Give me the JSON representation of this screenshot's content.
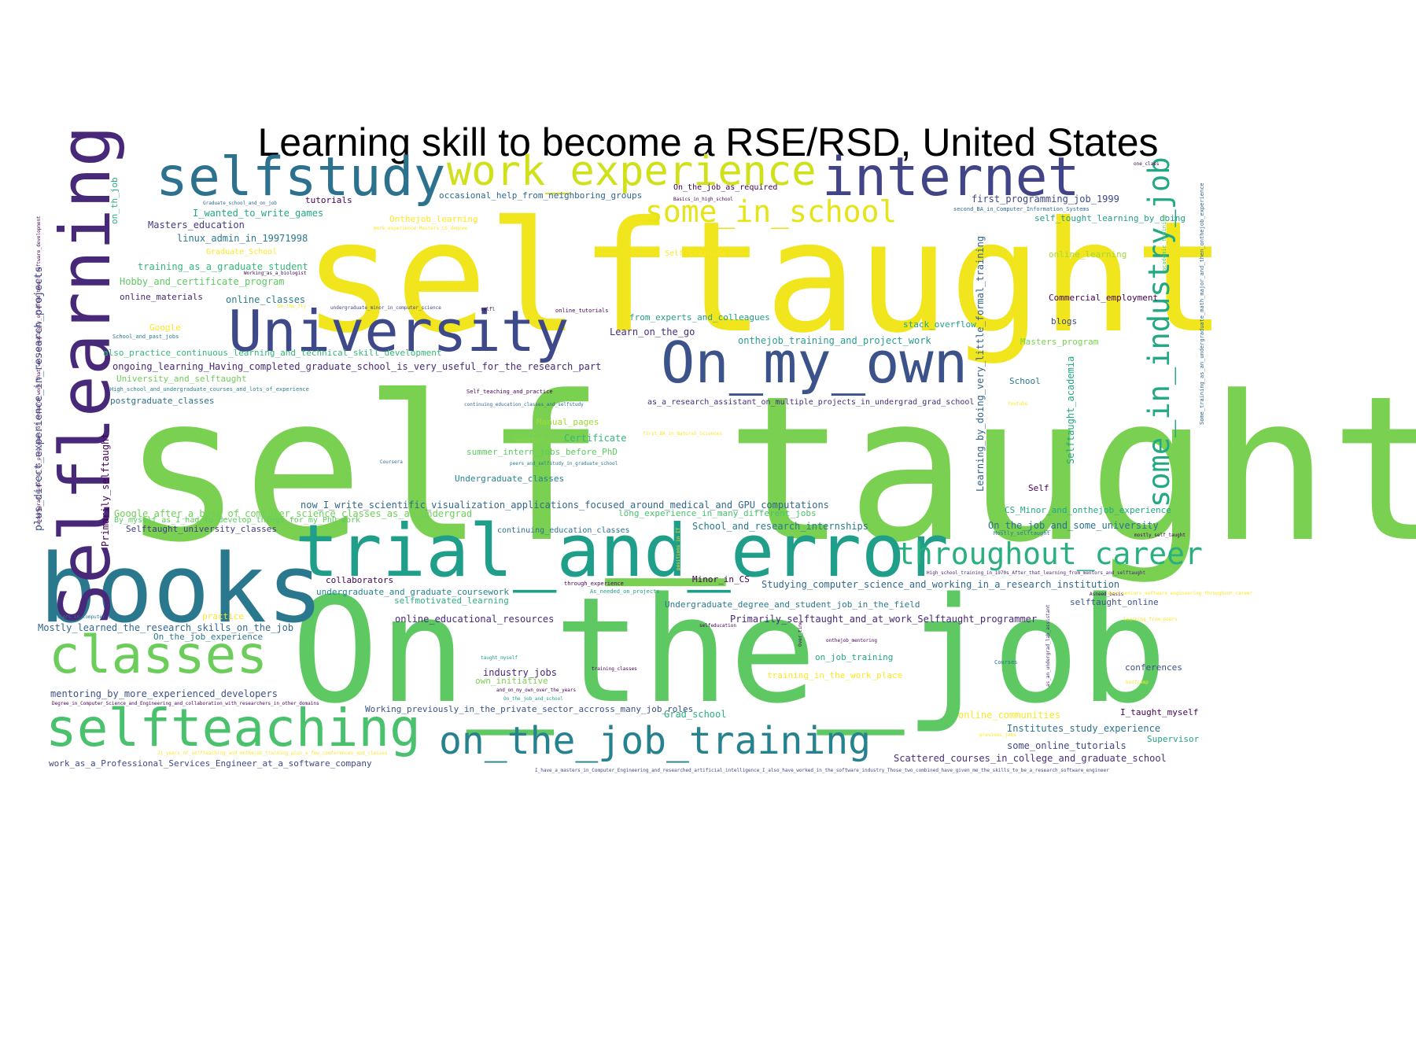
{
  "title": "Learning skill to become a RSE/RSD, United States",
  "words": [
    {
      "t": "self_taught",
      "c": "#7ad151"
    },
    {
      "t": "selftaught",
      "c": "#f1e51d"
    },
    {
      "t": "On_the_job",
      "c": "#5ec962"
    },
    {
      "t": "books",
      "c": "#2a788e"
    },
    {
      "t": "trial_and_error",
      "c": "#1f9e89"
    },
    {
      "t": "Selflearning",
      "c": "#482878"
    },
    {
      "t": "University",
      "c": "#3e4989"
    },
    {
      "t": "On_my_own",
      "c": "#3b528b"
    },
    {
      "t": "selfstudy",
      "c": "#2c728e"
    },
    {
      "t": "internet",
      "c": "#414487"
    },
    {
      "t": "work_experience",
      "c": "#d0e11c"
    },
    {
      "t": "classes",
      "c": "#6ccd5a"
    },
    {
      "t": "selfteaching",
      "c": "#4ac16d"
    },
    {
      "t": "on_the_job_training",
      "c": "#26828e"
    },
    {
      "t": "some_in_industry_job",
      "c": "#22a884"
    },
    {
      "t": "some_in_school",
      "c": "#e5e419"
    },
    {
      "t": "throughout_career",
      "c": "#2ab07f"
    },
    {
      "t": "plus_direct_experience_in_research_projects",
      "c": "#3b528b"
    },
    {
      "t": "Learning_by_doing_very_little_formal_training",
      "c": "#33638d"
    },
    {
      "t": "Selftaught_academia",
      "c": "#22a884"
    },
    {
      "t": "Primarily_selftaught",
      "c": "#440154"
    },
    {
      "t": "on_th_job",
      "c": "#29af7f"
    },
    {
      "t": "occasional_help_from_neighboring_groups",
      "c": "#31688e"
    },
    {
      "t": "tutorials",
      "c": "#440154"
    },
    {
      "t": "I_wanted_to_write_games",
      "c": "#22a884"
    },
    {
      "t": "Masters_education",
      "c": "#443983"
    },
    {
      "t": "linux_admin_in_19971998",
      "c": "#2a788e"
    },
    {
      "t": "Graduate_School",
      "c": "#fde725"
    },
    {
      "t": "training_as_a_graduate_student",
      "c": "#35b779"
    },
    {
      "t": "Working_as_a_biologist",
      "c": "#440154"
    },
    {
      "t": "Hobby_and_certificate_program",
      "c": "#5ec962"
    },
    {
      "t": "online_materials",
      "c": "#482878"
    },
    {
      "t": "online_classes",
      "c": "#287c8e"
    },
    {
      "t": "undergraduate_minor_in_computer_science",
      "c": "#414487"
    },
    {
      "t": "selfl",
      "c": "#440154"
    },
    {
      "t": "online_tutorials",
      "c": "#440154"
    },
    {
      "t": "Google",
      "c": "#fde725"
    },
    {
      "t": "School_and_past_jobs",
      "c": "#2a788e"
    },
    {
      "t": "also_practice_continuous_learning_and_technical_skill_development",
      "c": "#35b779"
    },
    {
      "t": "ongoing_learning_Having_completed_graduate_school_is_very_useful_for_the_research_part",
      "c": "#482878"
    },
    {
      "t": "University_and_selftaught",
      "c": "#6ece58"
    },
    {
      "t": "High_school_and_undergraduate_courses_and_lots_of_experience",
      "c": "#26828e"
    },
    {
      "t": "postgraduate_classes",
      "c": "#2c728e"
    },
    {
      "t": "Onthejob_learning",
      "c": "#fde725"
    },
    {
      "t": "Work_experience_Masters_CS_degree",
      "c": "#fde725"
    },
    {
      "t": "On_the_fly",
      "c": "#fde725"
    },
    {
      "t": "Self_training",
      "c": "#fde725"
    },
    {
      "t": "On_the_job_as_required",
      "c": "#440154"
    },
    {
      "t": "Basics_in_high_school",
      "c": "#440154"
    },
    {
      "t": "first_programming_job_1999",
      "c": "#3e4989"
    },
    {
      "t": "second_BA_in_Computer_Information_Systems",
      "c": "#31688e"
    },
    {
      "t": "self_tought_learning_by_doing",
      "c": "#1f9e89"
    },
    {
      "t": "one_class",
      "c": "#440154"
    },
    {
      "t": "online_learning",
      "c": "#a0da39"
    },
    {
      "t": "academic_training",
      "c": "#5ec962"
    },
    {
      "t": "Commercial_employment",
      "c": "#440154"
    },
    {
      "t": "Some_training_as_an_undergraduate_math_major_and_then_onthejob_experience",
      "c": "#31688e"
    },
    {
      "t": "blogs",
      "c": "#3e4989"
    },
    {
      "t": "from_experts_and_colleagues",
      "c": "#1f9e89"
    },
    {
      "t": "stack_overflow",
      "c": "#20a386"
    },
    {
      "t": "Learn_on_the_go",
      "c": "#472d7b"
    },
    {
      "t": "onthejob_training_and_project_work",
      "c": "#2a9d8f"
    },
    {
      "t": "Masters_program",
      "c": "#7ad151"
    },
    {
      "t": "School",
      "c": "#2a788e"
    },
    {
      "t": "Self_teaching_and_practice",
      "c": "#440154"
    },
    {
      "t": "continuing_education_classes_and_selfstudy",
      "c": "#31688e"
    },
    {
      "t": "as_a_research_assistant_on_multiple_projects_in_undergrad_grad_school",
      "c": "#472d7b"
    },
    {
      "t": "Youtube",
      "c": "#fde725"
    },
    {
      "t": "Manual_pages",
      "c": "#a0da39"
    },
    {
      "t": "mentor",
      "c": "#86d549"
    },
    {
      "t": "Certificate",
      "c": "#35b779"
    },
    {
      "t": "first_BA_in_Natural_Sciences",
      "c": "#fde725"
    },
    {
      "t": "summer_intern_jobs_before_PhD",
      "c": "#5ec962"
    },
    {
      "t": "Coursera",
      "c": "#31688e"
    },
    {
      "t": "peers_and_selfstudy_in_graduate_school",
      "c": "#2a788e"
    },
    {
      "t": "Undergraduate_classes",
      "c": "#26828e"
    },
    {
      "t": "Self",
      "c": "#440154"
    },
    {
      "t": "now_I_write_scientific_visualization_applications_focused_around_medical_and_GPU_computations",
      "c": "#31688e"
    },
    {
      "t": "Google_after_a_base_of_computer_science_classes_as_an_undergrad",
      "c": "#6ece58"
    },
    {
      "t": "long_experience_in_many_different_jobs",
      "c": "#4ac16d"
    },
    {
      "t": "By_myself_as_I_had_to_develop_things_for_my_PhD_work",
      "c": "#5ec962"
    },
    {
      "t": "Selftaught_university_classes",
      "c": "#443983"
    },
    {
      "t": "continuing_education_classes",
      "c": "#2c728e"
    },
    {
      "t": "School_and_research_internships",
      "c": "#2a788e"
    },
    {
      "t": "CS_Minor_and_onthejob_experience",
      "c": "#22a884"
    },
    {
      "t": "On_the_job_and_some_university",
      "c": "#2c728e"
    },
    {
      "t": "Mostly_selftaught",
      "c": "#2a788e"
    },
    {
      "t": "mostly_self_taught",
      "c": "#440154"
    },
    {
      "t": "underggrad_minor_in_CS_plus_years_of_research_work_that_was_increasingly_oriented_toward_software_development",
      "c": "#440154"
    },
    {
      "t": "positions_in_IT",
      "c": "#fde725"
    },
    {
      "t": "collaborators",
      "c": "#440154"
    },
    {
      "t": "undergraduate_and_graduate_coursework",
      "c": "#26828e"
    },
    {
      "t": "through_experience",
      "c": "#440154"
    },
    {
      "t": "As_needed_on_projects",
      "c": "#1f9e89"
    },
    {
      "t": "Minor_in_CS",
      "c": "#440154"
    },
    {
      "t": "Studying_computer_science_and_working_in_a_research_institution",
      "c": "#31688e"
    },
    {
      "t": "High_school_training_in_1970s_After_that_learning_from_mentors_and_selftaught",
      "c": "#482878"
    },
    {
      "t": "Asneed_basis",
      "c": "#440154"
    },
    {
      "t": "selfmotivated_learning",
      "c": "#29af7f"
    },
    {
      "t": "Undergraduate_degree_and_student_job_in_the_field",
      "c": "#2a788e"
    },
    {
      "t": "selftaught_online",
      "c": "#3b528b"
    },
    {
      "t": "Masters_in_Computer_Science",
      "c": "#2a788e"
    },
    {
      "t": "practice",
      "c": "#fde725"
    },
    {
      "t": "online_educational_resources",
      "c": "#482878"
    },
    {
      "t": "Primarily_selftaught_and_at_work_Selftaught_programmer",
      "c": "#482878"
    },
    {
      "t": "Mostly_learned_the_research_skills_on_the_job",
      "c": "#31688e"
    },
    {
      "t": "selfeducation",
      "c": "#440154"
    },
    {
      "t": "Over_time",
      "c": "#440154"
    },
    {
      "t": "onthejob_mentoring",
      "c": "#440154"
    },
    {
      "t": "On_the_job_experience",
      "c": "#2a788e"
    },
    {
      "t": "learning_from_peers",
      "c": "#fde725"
    },
    {
      "t": "more_seniors_software_engineering_throughout_career",
      "c": "#fde725"
    },
    {
      "t": "as_an_undergrad_lab_assistant",
      "c": "#482878"
    },
    {
      "t": "taught_myself",
      "c": "#1f9e89"
    },
    {
      "t": "training_classes",
      "c": "#440154"
    },
    {
      "t": "on_job_training",
      "c": "#22a884"
    },
    {
      "t": "Courses",
      "c": "#2c728e"
    },
    {
      "t": "conferences",
      "c": "#3b528b"
    },
    {
      "t": "industry_jobs",
      "c": "#482878"
    },
    {
      "t": "own_initiative",
      "c": "#7ad151"
    },
    {
      "t": "training_in_the_work_place",
      "c": "#fde725"
    },
    {
      "t": "mentoring_by_more_experienced_developers",
      "c": "#3b528b"
    },
    {
      "t": "and_on_my_own_over_the_years",
      "c": "#440154"
    },
    {
      "t": "On_the_job_and_school",
      "c": "#1f9e89"
    },
    {
      "t": "bootcamp",
      "c": "#fde725"
    },
    {
      "t": "Degree_in_Computer_Science_and_Engineering_and_collaboration_with_researchers_in_other_domains",
      "c": "#440154"
    },
    {
      "t": "Working_previously_in_the_private_sector_accross_many_job_roles",
      "c": "#3b528b"
    },
    {
      "t": "Grad_school",
      "c": "#2ab07f"
    },
    {
      "t": "online_communities",
      "c": "#fde725"
    },
    {
      "t": "I_taught_myself",
      "c": "#440154"
    },
    {
      "t": "Institutes_study_experience",
      "c": "#2c728e"
    },
    {
      "t": "previous_jobs",
      "c": "#fde725"
    },
    {
      "t": "Supervisor",
      "c": "#20a386"
    },
    {
      "t": "some_online_tutorials",
      "c": "#3e4989"
    },
    {
      "t": "21_years_of_selfteaching_and_onthejob_training_plus_a_few_conferences_and_classes",
      "c": "#fde725"
    },
    {
      "t": "work_as_a_Professional_Services_Engineer_at_a_software_company",
      "c": "#3e4989"
    },
    {
      "t": "Scattered_courses_in_college_and_graduate_school",
      "c": "#472d7b"
    },
    {
      "t": "I_have_a_masters_in_Computer_Engineering_and_researched_artificial_intelligence_I_also_have_worked_in_the_software_industry_Those_two_combined_have_given_me_the_skills_to_be_a_research_software_engineer",
      "c": "#3e4989"
    },
    {
      "t": "Graduate_school_and_on_job",
      "c": "#31688e"
    }
  ]
}
